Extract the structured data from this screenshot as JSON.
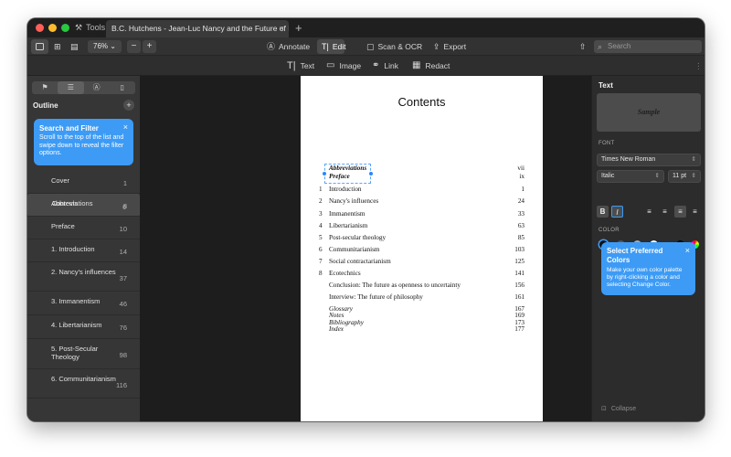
{
  "tabbar": {
    "tools_label": "Tools",
    "doc_tab_title": "B.C. Hutchens - Jean-Luc Nancy and the Future of Ph...",
    "close_glyph": "×",
    "new_tab_glyph": "+"
  },
  "toolbar": {
    "zoom_value": "76%",
    "zoom_out": "−",
    "zoom_in": "+",
    "annotate_label": "Annotate",
    "edit_label": "Edit",
    "scan_ocr_label": "Scan & OCR",
    "export_label": "Export",
    "search_placeholder": "Search"
  },
  "subtoolbar": {
    "text_label": "Text",
    "image_label": "Image",
    "link_label": "Link",
    "redact_label": "Redact"
  },
  "sidebar": {
    "outline_title": "Outline",
    "tip": {
      "title": "Search and Filter",
      "body": "Scroll to the top of the list and swipe down to reveal the filter options."
    },
    "items": [
      {
        "label": "Cover",
        "page": "1"
      },
      {
        "label": "Contents",
        "page": "6"
      },
      {
        "label": "Abbreviations",
        "page": "8"
      },
      {
        "label": "Preface",
        "page": "10"
      },
      {
        "label": "1. Introduction",
        "page": "14"
      },
      {
        "label": "2. Nancy's influences",
        "page": "37"
      },
      {
        "label": "3. Immanentism",
        "page": "46"
      },
      {
        "label": "4. Libertarianism",
        "page": "76"
      },
      {
        "label": "5. Post-Secular Theology",
        "page": "98"
      },
      {
        "label": "6. Communitarianism",
        "page": "116"
      }
    ]
  },
  "page": {
    "title": "Contents",
    "toc": [
      {
        "num": "",
        "text": "Abbreviations",
        "page": "vii",
        "italic": true
      },
      {
        "num": "",
        "text": "Preface",
        "page": "ix",
        "italic": true
      },
      {
        "num": "1",
        "text": "Introduction",
        "page": "1",
        "italic": false
      },
      {
        "num": "2",
        "text": "Nancy's influences",
        "page": "24",
        "italic": false
      },
      {
        "num": "3",
        "text": "Immanentism",
        "page": "33",
        "italic": false
      },
      {
        "num": "4",
        "text": "Libertarianism",
        "page": "63",
        "italic": false
      },
      {
        "num": "5",
        "text": "Post-secular theology",
        "page": "85",
        "italic": false
      },
      {
        "num": "6",
        "text": "Communitarianism",
        "page": "103",
        "italic": false
      },
      {
        "num": "7",
        "text": "Social contractarianism",
        "page": "125",
        "italic": false
      },
      {
        "num": "8",
        "text": "Ecotechnics",
        "page": "141",
        "italic": false
      },
      {
        "num": "",
        "text": "Conclusion: The future as openness to uncertainty",
        "page": "156",
        "italic": false
      },
      {
        "num": "",
        "text": "Interview: The future of philosophy",
        "page": "161",
        "italic": false
      },
      {
        "num": "",
        "text": "Glossary",
        "page": "167",
        "italic": true
      },
      {
        "num": "",
        "text": "Notes",
        "page": "169",
        "italic": true
      },
      {
        "num": "",
        "text": "Bibliography",
        "page": "173",
        "italic": true
      },
      {
        "num": "",
        "text": "Index",
        "page": "177",
        "italic": true
      }
    ]
  },
  "right_panel": {
    "title": "Text",
    "sample_text": "Sample",
    "font_label": "FONT",
    "font_family": "Times New Roman",
    "font_style": "Italic",
    "font_size": "11 pt",
    "bold_label": "B",
    "italic_label": "I",
    "color_label": "COLOR",
    "colors": [
      "#111111",
      "#555555",
      "#aaaaaa",
      "#ffffff",
      "#000000"
    ],
    "tip": {
      "title": "Select Preferred Colors",
      "body": "Make your own color palette by right-clicking a color and selecting Change Color."
    },
    "collapse_label": "Collapse"
  }
}
